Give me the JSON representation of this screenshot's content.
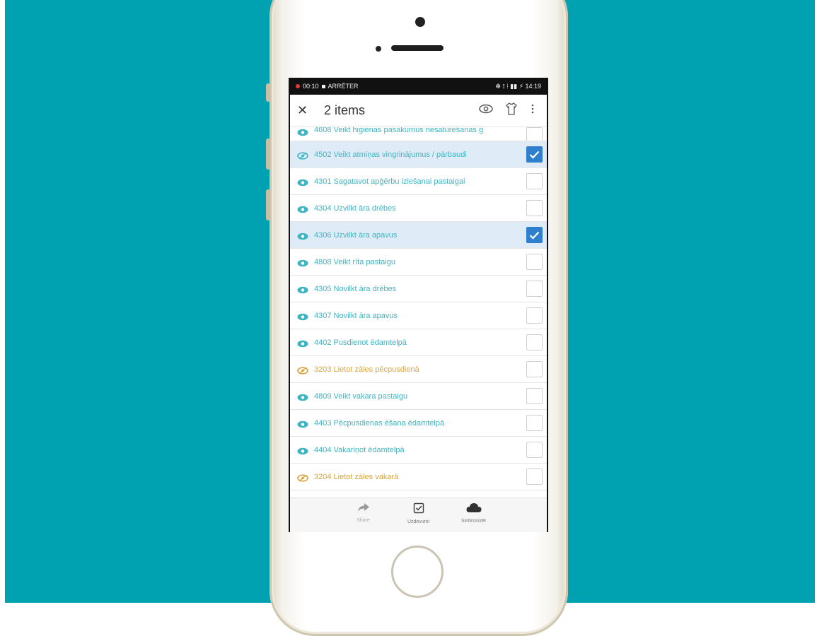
{
  "statusbar": {
    "recording": "00:10",
    "stop_label": "ARRÊTER",
    "right": "✻ ⟟ ⁞ ▮▮ ⚡ 14:19"
  },
  "appbar": {
    "title": "2 items",
    "close_icon": "close-icon",
    "actions": [
      "eye-icon",
      "shirt-icon",
      "more-vert-icon"
    ]
  },
  "list": {
    "items": [
      {
        "text": "4608 Veikt higiēnas pasākumus nesaturēšanas g",
        "checked": false,
        "color": "teal",
        "icon": "eye-icon"
      },
      {
        "text": "4502 Veikt atmiņas vingrinājumus / pārbaudi",
        "checked": true,
        "color": "teal",
        "icon": "eye-slash-icon"
      },
      {
        "text": "4301 Sagatavot apģērbu iziešanai pastaigai",
        "checked": false,
        "color": "teal",
        "icon": "eye-icon"
      },
      {
        "text": "4304 Uzvilkt āra drēbes",
        "checked": false,
        "color": "teal",
        "icon": "eye-icon"
      },
      {
        "text": "4306 Uzvilkt āra apavus",
        "checked": true,
        "color": "teal",
        "icon": "eye-icon"
      },
      {
        "text": "4808 Veikt rīta pastaigu",
        "checked": false,
        "color": "teal",
        "icon": "eye-icon"
      },
      {
        "text": "4305 Novilkt āra drēbes",
        "checked": false,
        "color": "teal",
        "icon": "eye-icon"
      },
      {
        "text": "4307 Novilkt āra apavus",
        "checked": false,
        "color": "teal",
        "icon": "eye-icon"
      },
      {
        "text": "4402 Pusdienot ēdamtelpā",
        "checked": false,
        "color": "teal",
        "icon": "eye-icon"
      },
      {
        "text": "3203 Lietot zāles pēcpusdienā",
        "checked": false,
        "color": "orange",
        "icon": "eye-slash-icon"
      },
      {
        "text": "4809 Veikt vakara pastaigu",
        "checked": false,
        "color": "teal",
        "icon": "eye-icon"
      },
      {
        "text": "4403 Pēcpusdienas ēšana ēdamtelpā",
        "checked": false,
        "color": "teal",
        "icon": "eye-icon"
      },
      {
        "text": "4404 Vakariņot ēdamtelpā",
        "checked": false,
        "color": "teal",
        "icon": "eye-icon"
      },
      {
        "text": "3204 Lietot zāles vakarā",
        "checked": false,
        "color": "orange",
        "icon": "eye-slash-icon"
      }
    ]
  },
  "bottombar": {
    "tabs": [
      {
        "label": "Share",
        "icon": "share-icon",
        "dim": true
      },
      {
        "label": "Uzdevumi",
        "icon": "checkbox-icon",
        "dim": false
      },
      {
        "label": "Sinhronizēt",
        "icon": "cloud-icon",
        "dim": false
      }
    ]
  },
  "colors": {
    "background": "#00a1b1",
    "teal_text": "#3fb4c2",
    "orange_text": "#d9a43e",
    "selected_row": "#dfecf8",
    "checkbox_on": "#2f7fce"
  }
}
